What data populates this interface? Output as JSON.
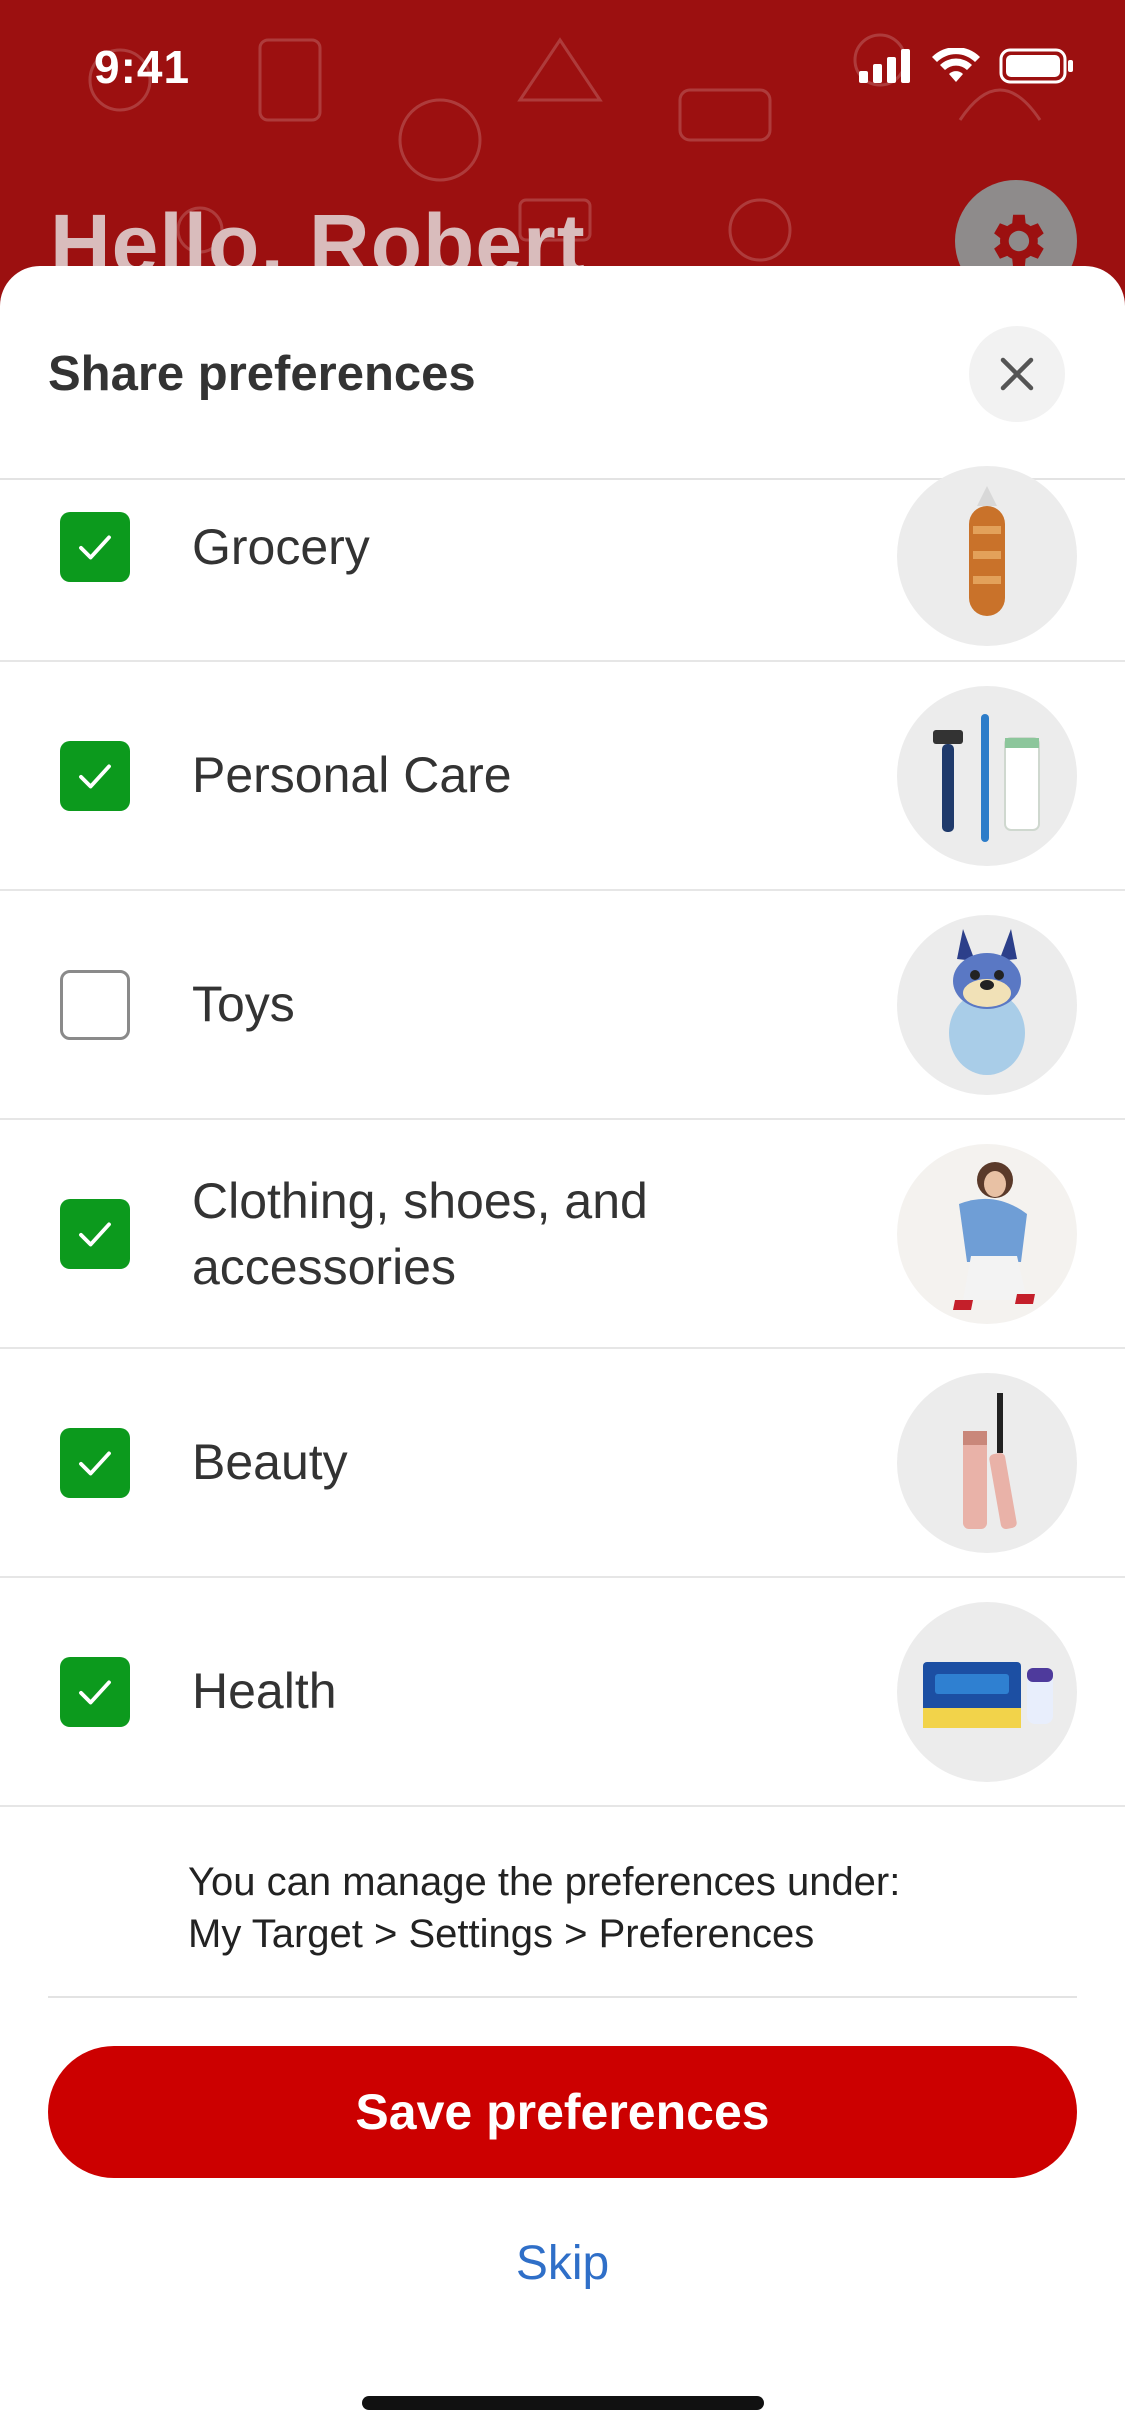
{
  "status_bar": {
    "time": "9:41"
  },
  "header": {
    "greeting": "Hello, Robert"
  },
  "sheet": {
    "title": "Share preferences",
    "items": [
      {
        "label": "Grocery",
        "checked": true,
        "image": "bread-loaf"
      },
      {
        "label": "Personal Care",
        "checked": true,
        "image": "razor-toothbrush-deodorant"
      },
      {
        "label": "Toys",
        "checked": false,
        "image": "bluey-plush"
      },
      {
        "label": "Clothing, shoes, and accessories",
        "checked": true,
        "image": "woman-denim-jacket"
      },
      {
        "label": "Beauty",
        "checked": true,
        "image": "mascara"
      },
      {
        "label": "Health",
        "checked": true,
        "image": "tampax-box"
      }
    ],
    "note_line1": "You can manage the preferences under:",
    "note_line2": "My Target > Settings > Preferences",
    "save_label": "Save preferences",
    "skip_label": "Skip"
  },
  "colors": {
    "brand_red": "#cc0000",
    "check_green": "#0c9a1d",
    "link_blue": "#2f6fc8"
  }
}
